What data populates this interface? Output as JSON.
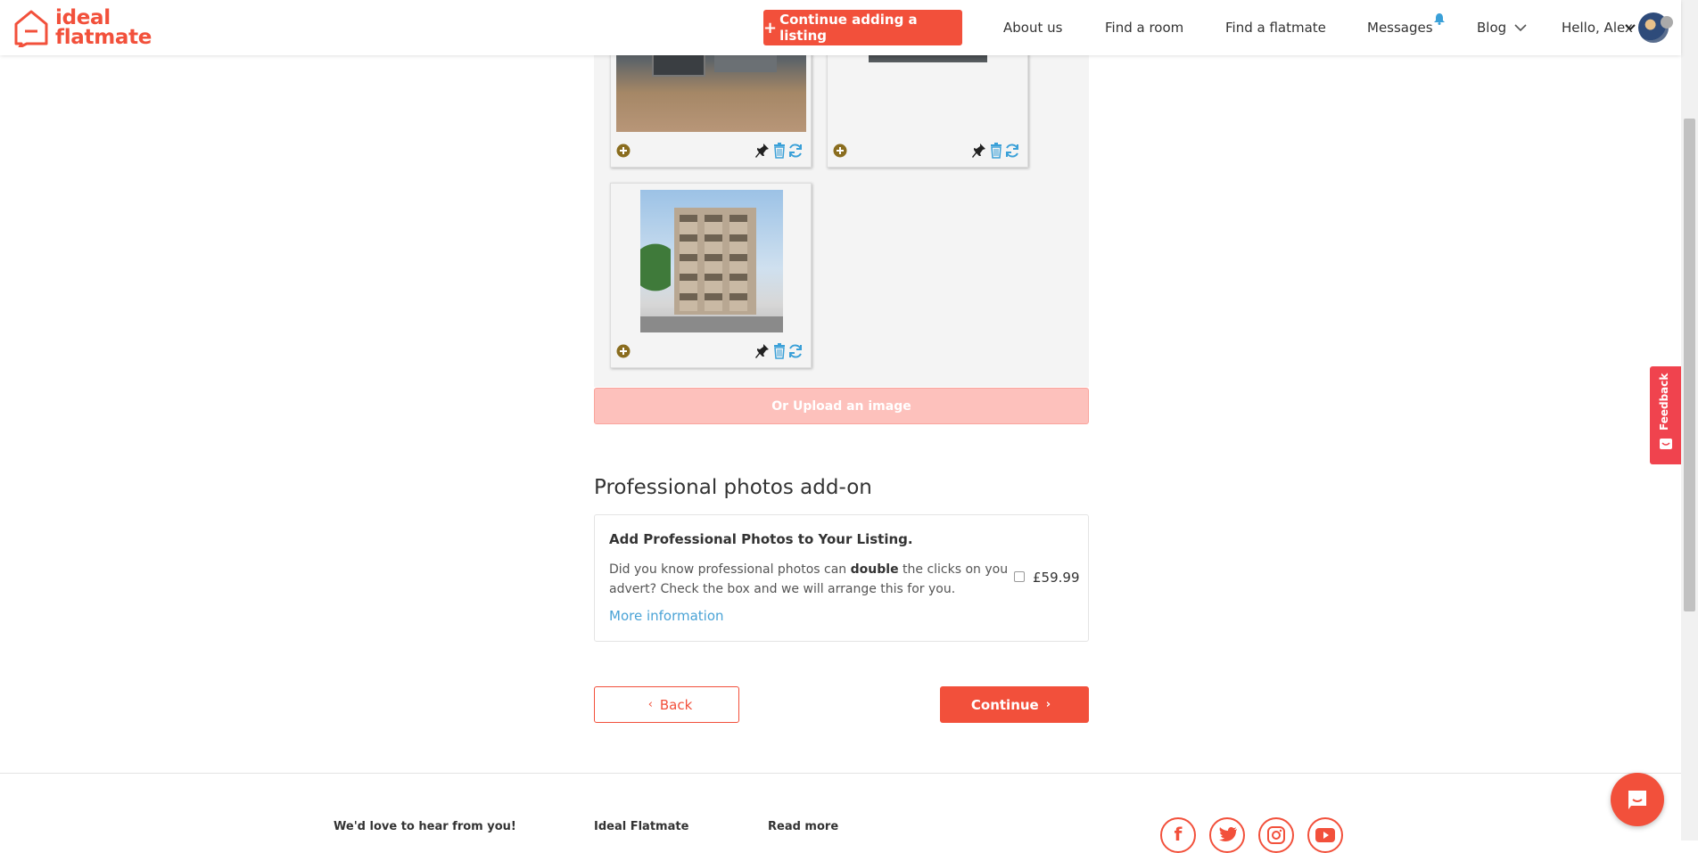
{
  "brand": {
    "logo_line1": "ideal",
    "logo_line2": "flatmate",
    "accent": "#f2503b"
  },
  "header": {
    "cta": "Continue adding a listing",
    "nav": [
      "About us",
      "Find a room",
      "Find a flatmate",
      "Messages",
      "Blog",
      "Hello, Alex"
    ]
  },
  "photos": {
    "cards": [
      {
        "image": "building-photo-1"
      },
      {
        "image": "building-photo-2"
      },
      {
        "image": "apartment-building-photo"
      }
    ],
    "upload_label": "Or Upload an image"
  },
  "addon": {
    "section_title": "Professional photos add-on",
    "heading": "Add Professional Photos to Your Listing.",
    "desc_part1": "Did you know professional photos can ",
    "desc_bold": "double",
    "desc_part2": " the clicks on you advert? Check the box and we will arrange this for you.",
    "more_link": "More information",
    "price": "£59.99",
    "checked": false
  },
  "buttons": {
    "back": "Back",
    "continue": "Continue"
  },
  "footer": {
    "headings": [
      "We'd love to hear from you!",
      "Ideal Flatmate",
      "Read more"
    ],
    "social_icons": [
      "facebook-icon",
      "twitter-icon",
      "instagram-icon",
      "youtube-icon"
    ]
  },
  "feedback": {
    "label": "Feedback"
  }
}
